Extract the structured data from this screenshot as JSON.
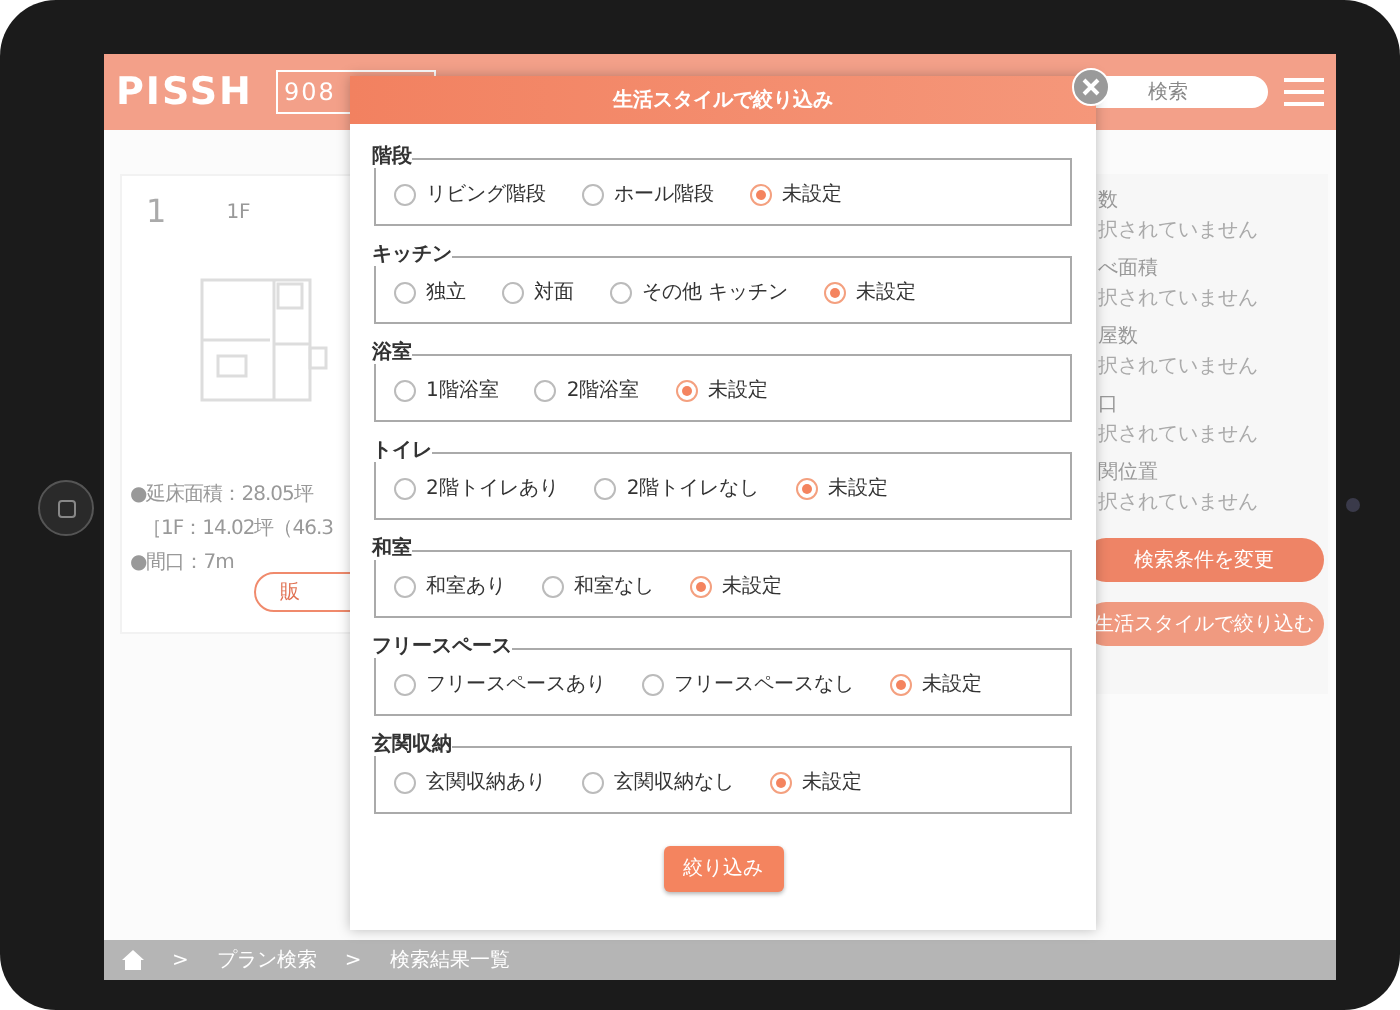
{
  "header": {
    "logo": "PISSH",
    "field_text": "908",
    "search_text": "検索"
  },
  "plan_card": {
    "number": "1",
    "floor": "1F",
    "details": [
      "●延床面積：28.05坪",
      "［1F：14.02坪（46.3",
      "●間口：7m"
    ],
    "button": "販"
  },
  "conditions": [
    {
      "label": "数",
      "value": "択されていません"
    },
    {
      "label": "べ面積",
      "value": "択されていません"
    },
    {
      "label": "屋数",
      "value": "択されていません"
    },
    {
      "label": "口",
      "value": "択されていません"
    },
    {
      "label": "関位置",
      "value": "択されていません"
    }
  ],
  "condition_buttons": [
    "検索条件を変更",
    "生活スタイルで絞り込む"
  ],
  "breadcrumb": [
    {
      "separator": ">",
      "label": "プラン検索"
    },
    {
      "separator": ">",
      "label": "検索結果一覧"
    }
  ],
  "dialog": {
    "title": "生活スタイルで絞り込み",
    "groups": [
      {
        "legend": "階段",
        "options": [
          {
            "label": "リビング階段",
            "selected": false
          },
          {
            "label": "ホール階段",
            "selected": false
          },
          {
            "label": "未設定",
            "selected": true
          }
        ]
      },
      {
        "legend": "キッチン",
        "options": [
          {
            "label": "独立",
            "selected": false
          },
          {
            "label": "対面",
            "selected": false
          },
          {
            "label": "その他 キッチン",
            "selected": false
          },
          {
            "label": "未設定",
            "selected": true
          }
        ]
      },
      {
        "legend": "浴室",
        "options": [
          {
            "label": "1階浴室",
            "selected": false
          },
          {
            "label": "2階浴室",
            "selected": false
          },
          {
            "label": "未設定",
            "selected": true
          }
        ]
      },
      {
        "legend": "トイレ",
        "options": [
          {
            "label": "2階トイレあり",
            "selected": false
          },
          {
            "label": "2階トイレなし",
            "selected": false
          },
          {
            "label": "未設定",
            "selected": true
          }
        ]
      },
      {
        "legend": "和室",
        "options": [
          {
            "label": "和室あり",
            "selected": false
          },
          {
            "label": "和室なし",
            "selected": false
          },
          {
            "label": "未設定",
            "selected": true
          }
        ]
      },
      {
        "legend": "フリースペース",
        "options": [
          {
            "label": "フリースペースあり",
            "selected": false
          },
          {
            "label": "フリースペースなし",
            "selected": false
          },
          {
            "label": "未設定",
            "selected": true
          }
        ]
      },
      {
        "legend": "玄関収納",
        "options": [
          {
            "label": "玄関収納あり",
            "selected": false
          },
          {
            "label": "玄関収納なし",
            "selected": false
          },
          {
            "label": "未設定",
            "selected": true
          }
        ]
      }
    ],
    "submit": "絞り込み"
  }
}
